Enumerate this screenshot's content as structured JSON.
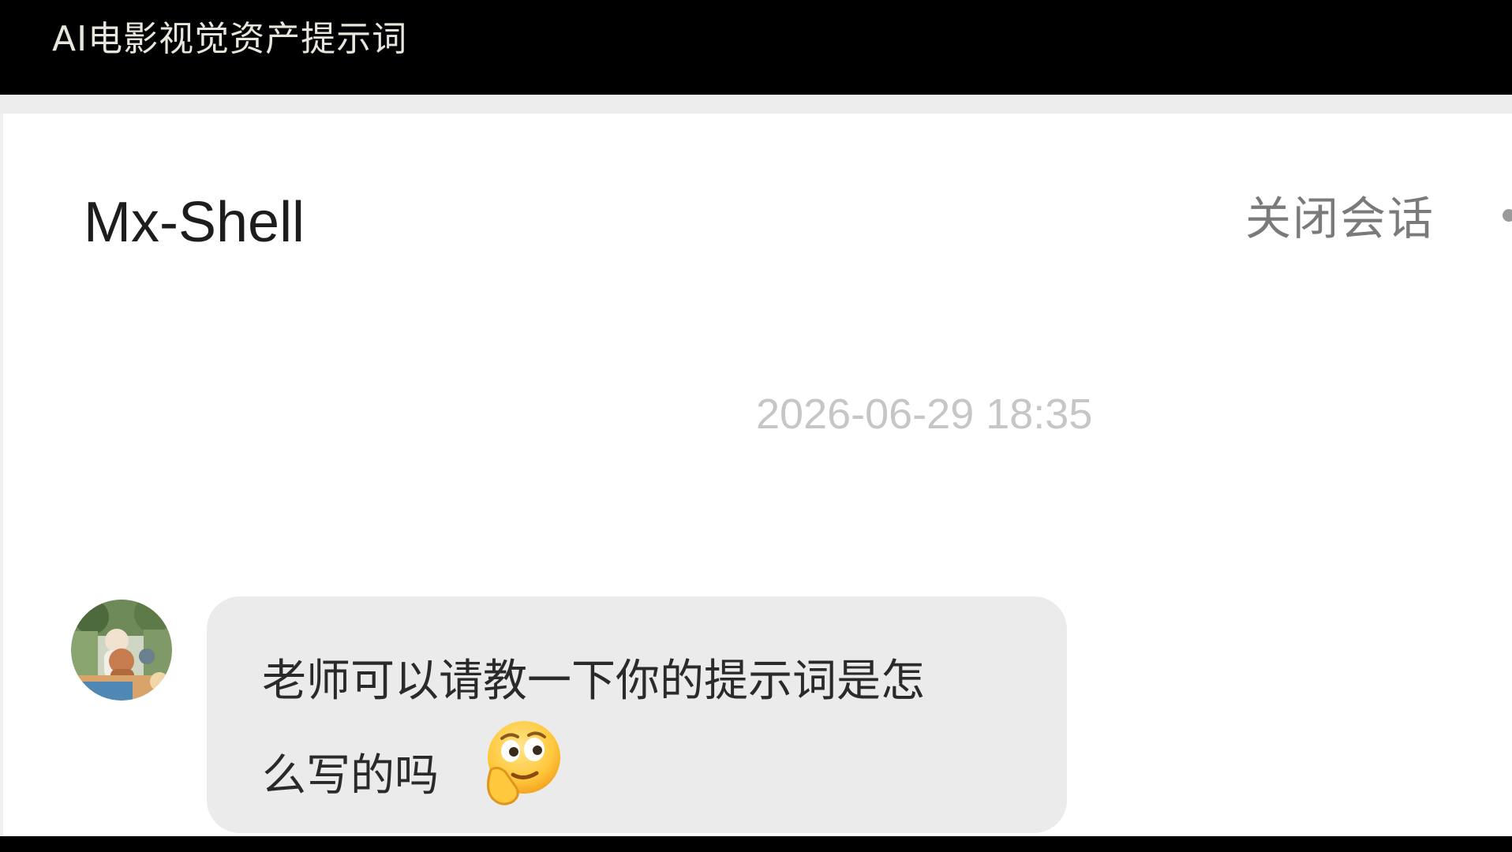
{
  "window": {
    "title": "AI电影视觉资产提示词"
  },
  "chat": {
    "contact_name": "Mx-Shell",
    "close_label": "关闭会话",
    "messages": [
      {
        "timestamp": "2026-06-29 18:35",
        "text_line1": "老师可以请教一下你的提示词是怎",
        "text_line2": "么写的吗",
        "emoji": "thinking-face-emoji"
      }
    ]
  },
  "colors": {
    "topbar_bg": "#000000",
    "title_text": "#e8e6dc",
    "bubble_bg": "#ebebeb",
    "timestamp_text": "#c6c6c6",
    "close_text": "#7a7a7a"
  }
}
